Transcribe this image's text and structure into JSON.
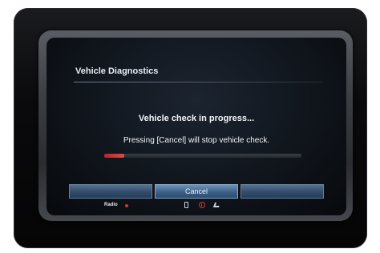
{
  "screen": {
    "title": "Vehicle Diagnostics",
    "message_primary": "Vehicle check in progress...",
    "message_secondary": "Pressing [Cancel] will stop vehicle check."
  },
  "progress": {
    "value": 0.1,
    "track_color": "#2f343b",
    "fill_color": "#c8343a"
  },
  "buttons": {
    "left_label": "",
    "center_label": "Cancel",
    "right_label": ""
  },
  "status_bar": {
    "radio_label": "Radio",
    "icons": [
      "phone-icon",
      "alert-icon",
      "signal-icon"
    ]
  },
  "colors": {
    "button_blue": "#3e6188",
    "text": "#f2f5f8",
    "accent_red": "#d8313a"
  }
}
